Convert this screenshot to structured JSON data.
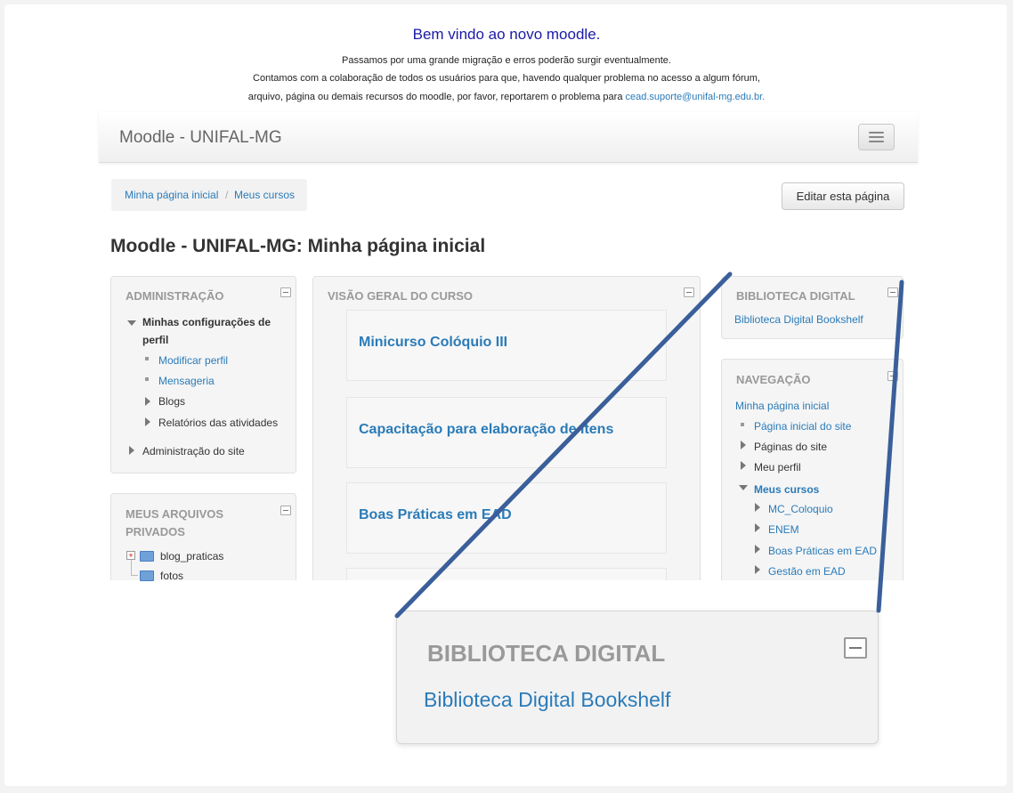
{
  "notice": {
    "title": "Bem vindo ao novo moodle.",
    "line1": "Passamos por uma grande migração e erros poderão surgir eventualmente.",
    "line2": "Contamos com a colaboração de todos os usuários para que, havendo qualquer problema no acesso a algum fórum,",
    "line3": "arquivo, página ou demais recursos do moodle, por favor, reportarem o problema para",
    "email": "cead.suporte@unifal-mg.edu.br."
  },
  "navbar": {
    "brand": "Moodle - UNIFAL-MG"
  },
  "breadcrumb": {
    "home": "Minha página inicial",
    "separator": "/",
    "courses": "Meus cursos"
  },
  "edit_button": "Editar esta página",
  "page_title": "Moodle - UNIFAL-MG: Minha página inicial",
  "admin_block": {
    "title": "ADMINISTRAÇÃO",
    "profile_settings_1": "Minhas configurações de",
    "profile_settings_2": "perfil",
    "edit_profile": "Modificar perfil",
    "messaging": "Mensageria",
    "blogs": "Blogs",
    "activity_reports": "Relatórios das atividades",
    "site_admin": "Administração do site"
  },
  "files_block": {
    "title_1": "MEUS ARQUIVOS",
    "title_2": "PRIVADOS",
    "folder_1": "blog_praticas",
    "folder_2": "fotos"
  },
  "course_overview": {
    "title": "VISÃO GERAL DO CURSO",
    "courses": [
      "Minicurso Colóquio III",
      "Capacitação para elaboração de itens",
      "Boas Práticas em EAD"
    ]
  },
  "library_block": {
    "title": "BIBLIOTECA DIGITAL",
    "link": "Biblioteca Digital Bookshelf"
  },
  "navigation_block": {
    "title": "NAVEGAÇÃO",
    "home": "Minha página inicial",
    "site_home": "Página inicial do site",
    "site_pages": "Páginas do site",
    "my_profile": "Meu perfil",
    "my_courses": "Meus cursos",
    "courses": [
      "MC_Coloquio",
      "ENEM",
      "Boas Práticas em EAD",
      "Gestão em EAD"
    ]
  },
  "zoom": {
    "title": "BIBLIOTECA DIGITAL",
    "link": "Biblioteca Digital Bookshelf"
  },
  "colors": {
    "link": "#2a7bb8",
    "callout_line": "#3a5f9a",
    "notice_title": "#1a1aa6"
  }
}
